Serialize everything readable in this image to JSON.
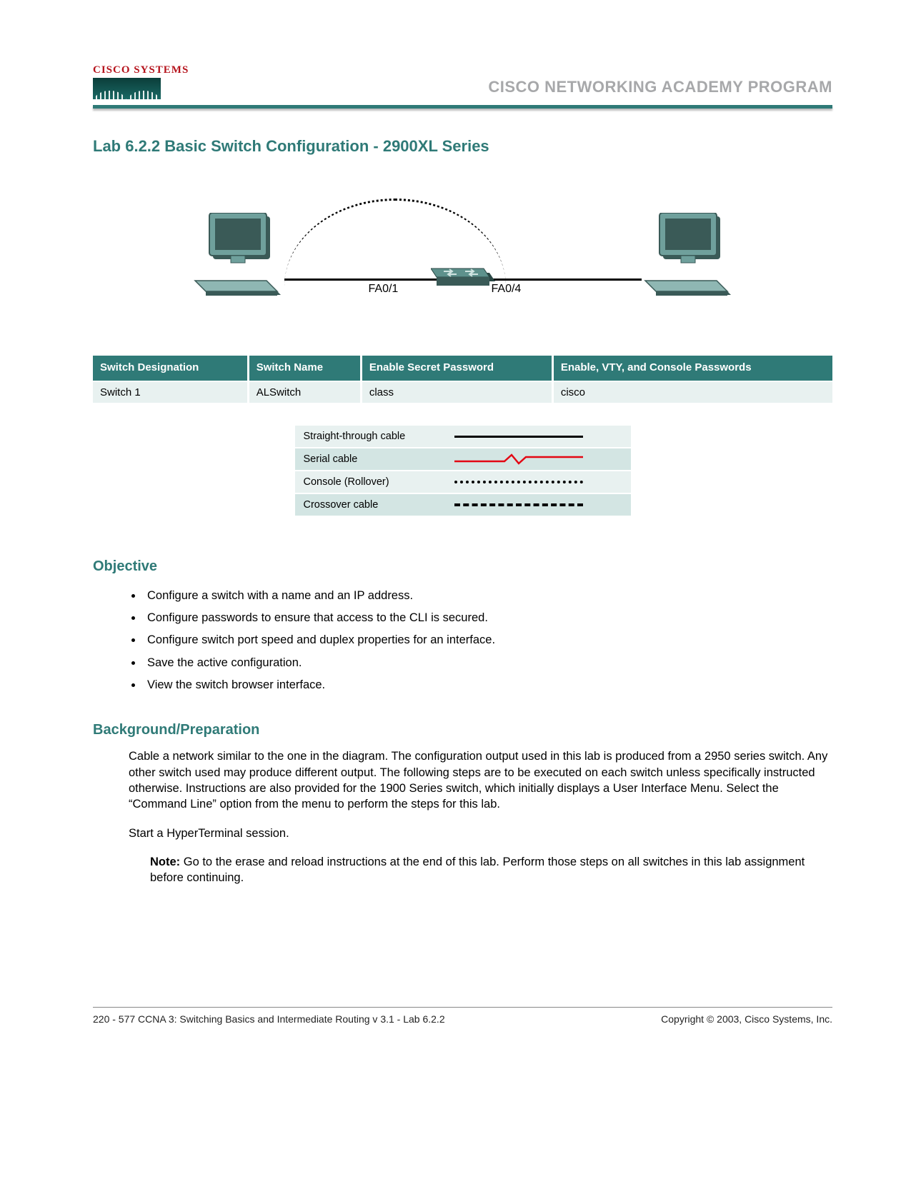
{
  "header": {
    "logo_text": "CISCO SYSTEMS",
    "program": "CISCO NETWORKING ACADEMY PROGRAM"
  },
  "title": "Lab 6.2.2 Basic Switch Configuration - 2900XL Series",
  "diagram": {
    "port_left": "FA0/1",
    "port_right": "FA0/4"
  },
  "cfg_table": {
    "headers": [
      "Switch Designation",
      "Switch Name",
      "Enable Secret Password",
      "Enable, VTY, and Console Passwords"
    ],
    "row": [
      "Switch 1",
      "ALSwitch",
      "class",
      "cisco"
    ]
  },
  "legend": {
    "rows": [
      {
        "label": "Straight-through cable",
        "type": "solid"
      },
      {
        "label": "Serial cable",
        "type": "serial"
      },
      {
        "label": "Console (Rollover)",
        "type": "dots"
      },
      {
        "label": "Crossover cable",
        "type": "dash"
      }
    ]
  },
  "sections": {
    "objective_h": "Objective",
    "objectives": [
      "Configure a switch with a name and an IP address.",
      "Configure passwords to ensure that access to the CLI is secured.",
      "Configure switch port speed and duplex properties for an interface.",
      "Save the active configuration.",
      "View the switch browser interface."
    ],
    "bg_h": "Background/Preparation",
    "bg_p1": "Cable a network similar to the one in the diagram. The configuration output used in this lab is produced from a 2950 series switch. Any other switch used may produce different output. The following steps are to be executed on each switch unless specifically instructed otherwise. Instructions are also provided for the 1900 Series switch, which initially displays a User Interface Menu. Select the “Command Line” option from the menu to perform the steps for this lab.",
    "bg_p2": "Start a HyperTerminal session.",
    "note_label": "Note:",
    "note_body": " Go to the erase and reload instructions at the end of this lab. Perform those steps on all switches in this lab assignment before continuing."
  },
  "footer": {
    "left": "220 - 577   CCNA 3: Switching Basics and Intermediate Routing v 3.1 - Lab 6.2.2",
    "right": "Copyright © 2003, Cisco Systems, Inc."
  }
}
